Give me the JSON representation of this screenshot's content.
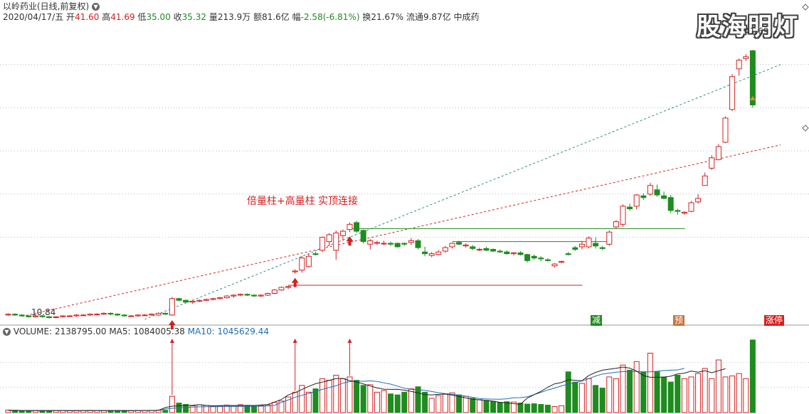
{
  "header": {
    "title": "以岭药业(日线,前复权)",
    "date": "2020/04/17/五",
    "open_label": "开",
    "open": "41.60",
    "high_label": "高",
    "high": "41.69",
    "low_label": "低",
    "low": "35.00",
    "close_label": "收",
    "close": "35.32",
    "vol_label": "量",
    "vol": "213.9万",
    "amount_label": "额",
    "amount": "81.6亿",
    "change_label": "幅",
    "change": "-2.58(-6.81%)",
    "turnover_label": "换",
    "turnover": "21.67%",
    "float_label": "流通",
    "float": "9.87亿",
    "sector": "中成药"
  },
  "watermark": "股海明灯",
  "annotation": "倍量柱+高量柱 实顶连接",
  "price_labels": {
    "low_mark": "10.84",
    "high_mark": "41.69"
  },
  "markers": {
    "jian": "减",
    "yu": "预",
    "zhangting": "涨停"
  },
  "volume_header": {
    "vol_label": "VOLUME:",
    "vol": "2138795.00",
    "ma5_label": "MA5:",
    "ma5": "1084005.38",
    "ma10_label": "MA10:",
    "ma10": "1045629.44"
  },
  "colors": {
    "up": "#d62020",
    "down": "#1e8c1e",
    "ma5": "#222222",
    "ma10": "#1e6fb8",
    "grid": "#bbbbbb"
  },
  "chart_data": {
    "type": "candlestick",
    "price_axis": [
      10,
      45
    ],
    "volume_axis": [
      0,
      2200000
    ],
    "candles": [
      [
        11.0,
        11.2,
        10.9,
        11.1
      ],
      [
        11.1,
        11.2,
        10.9,
        11.0
      ],
      [
        11.0,
        11.1,
        10.84,
        10.9
      ],
      [
        10.9,
        11.0,
        10.7,
        10.8
      ],
      [
        10.8,
        11.0,
        10.7,
        10.9
      ],
      [
        10.9,
        11.0,
        10.7,
        10.8
      ],
      [
        10.8,
        10.9,
        10.6,
        10.7
      ],
      [
        10.7,
        10.9,
        10.6,
        10.8
      ],
      [
        10.8,
        11.0,
        10.7,
        10.9
      ],
      [
        10.9,
        11.0,
        10.8,
        10.9
      ],
      [
        10.9,
        11.1,
        10.8,
        11.0
      ],
      [
        11.0,
        11.1,
        10.9,
        11.0
      ],
      [
        11.0,
        11.2,
        10.9,
        11.1
      ],
      [
        11.1,
        11.2,
        11.0,
        11.1
      ],
      [
        11.1,
        11.3,
        11.0,
        11.2
      ],
      [
        11.2,
        11.3,
        11.0,
        11.1
      ],
      [
        11.1,
        11.2,
        10.9,
        11.0
      ],
      [
        11.0,
        11.1,
        10.8,
        10.9
      ],
      [
        10.9,
        11.0,
        10.8,
        10.9
      ],
      [
        10.9,
        11.1,
        10.8,
        11.0
      ],
      [
        11.0,
        11.1,
        10.9,
        11.0
      ],
      [
        11.0,
        11.2,
        10.9,
        11.1
      ],
      [
        11.0,
        11.3,
        10.9,
        11.2
      ],
      [
        11.2,
        11.3,
        11.0,
        11.1
      ],
      [
        11.0,
        13.1,
        10.9,
        12.9
      ],
      [
        12.9,
        13.0,
        12.6,
        12.7
      ],
      [
        12.7,
        12.8,
        12.4,
        12.5
      ],
      [
        12.5,
        12.7,
        12.3,
        12.6
      ],
      [
        12.6,
        12.8,
        12.5,
        12.7
      ],
      [
        12.7,
        12.9,
        12.6,
        12.8
      ],
      [
        12.8,
        13.0,
        12.7,
        12.9
      ],
      [
        12.9,
        13.1,
        12.8,
        13.0
      ],
      [
        13.0,
        13.3,
        12.9,
        13.2
      ],
      [
        13.2,
        13.4,
        13.0,
        13.3
      ],
      [
        13.3,
        13.5,
        13.2,
        13.4
      ],
      [
        13.4,
        13.5,
        13.2,
        13.3
      ],
      [
        13.3,
        13.4,
        13.1,
        13.2
      ],
      [
        13.2,
        13.4,
        13.1,
        13.3
      ],
      [
        13.3,
        13.6,
        13.2,
        13.5
      ],
      [
        13.5,
        14.0,
        13.4,
        13.9
      ],
      [
        13.9,
        14.3,
        13.8,
        14.2
      ],
      [
        14.2,
        14.4,
        14.0,
        14.3
      ],
      [
        16.0,
        16.3,
        15.8,
        16.1
      ],
      [
        16.2,
        17.8,
        15.9,
        17.6
      ],
      [
        16.6,
        18.1,
        16.5,
        17.8
      ],
      [
        18.1,
        18.3,
        17.9,
        18.0
      ],
      [
        18.5,
        20.1,
        18.3,
        20.0
      ],
      [
        19.5,
        20.5,
        19.0,
        20.3
      ],
      [
        18.5,
        20.8,
        17.4,
        20.5
      ],
      [
        20.2,
        20.9,
        19.6,
        20.7
      ],
      [
        20.9,
        21.7,
        20.6,
        21.5
      ],
      [
        21.7,
        21.9,
        20.5,
        20.7
      ],
      [
        20.8,
        20.9,
        19.3,
        19.5
      ],
      [
        19.2,
        19.8,
        18.6,
        19.6
      ],
      [
        19.3,
        19.6,
        19.1,
        19.4
      ],
      [
        19.3,
        19.6,
        19.1,
        19.3
      ],
      [
        19.3,
        19.5,
        19.0,
        19.2
      ],
      [
        19.3,
        19.4,
        18.8,
        18.9
      ],
      [
        19.3,
        19.4,
        19.0,
        19.2
      ],
      [
        19.4,
        19.9,
        19.1,
        19.6
      ],
      [
        19.6,
        19.8,
        18.6,
        18.8
      ],
      [
        18.3,
        18.9,
        17.8,
        18.1
      ],
      [
        17.9,
        18.3,
        17.7,
        18.1
      ],
      [
        18.0,
        18.5,
        17.9,
        18.3
      ],
      [
        18.4,
        19.0,
        18.2,
        18.8
      ],
      [
        18.9,
        19.4,
        18.7,
        19.3
      ],
      [
        19.4,
        19.6,
        19.1,
        19.2
      ],
      [
        19.0,
        19.3,
        18.8,
        19.1
      ],
      [
        18.9,
        19.1,
        18.5,
        18.7
      ],
      [
        18.6,
        18.8,
        18.4,
        18.6
      ],
      [
        18.7,
        18.9,
        18.4,
        18.5
      ],
      [
        18.6,
        18.7,
        18.3,
        18.4
      ],
      [
        18.4,
        18.6,
        18.2,
        18.3
      ],
      [
        18.3,
        18.5,
        18.0,
        18.1
      ],
      [
        18.1,
        18.3,
        17.9,
        18.2
      ],
      [
        18.2,
        18.4,
        17.9,
        18.0
      ],
      [
        18.0,
        18.1,
        17.1,
        17.3
      ],
      [
        17.8,
        18.0,
        17.4,
        17.6
      ],
      [
        17.6,
        17.8,
        17.2,
        17.5
      ],
      [
        17.4,
        17.6,
        17.2,
        17.3
      ],
      [
        16.7,
        17.0,
        16.5,
        16.9
      ],
      [
        17.1,
        17.3,
        17.0,
        17.2
      ],
      [
        18.1,
        18.3,
        17.9,
        18.0
      ],
      [
        18.8,
        19.0,
        18.4,
        18.6
      ],
      [
        18.9,
        19.6,
        18.6,
        19.2
      ],
      [
        18.9,
        20.1,
        18.7,
        19.9
      ],
      [
        19.3,
        20.0,
        18.7,
        19.0
      ],
      [
        18.8,
        19.0,
        18.5,
        18.7
      ],
      [
        19.2,
        20.8,
        19.0,
        20.6
      ],
      [
        21.2,
        22.0,
        21.0,
        21.8
      ],
      [
        21.5,
        23.8,
        21.2,
        23.6
      ],
      [
        23.5,
        23.9,
        23.1,
        23.3
      ],
      [
        23.6,
        25.0,
        23.2,
        24.9
      ],
      [
        24.8,
        25.1,
        24.3,
        24.6
      ],
      [
        25.0,
        26.3,
        24.8,
        26.0
      ],
      [
        25.5,
        26.1,
        24.7,
        24.9
      ],
      [
        24.8,
        25.3,
        24.4,
        24.5
      ],
      [
        24.6,
        24.9,
        22.8,
        23.1
      ],
      [
        23.1,
        23.3,
        22.6,
        23.0
      ],
      [
        22.8,
        23.0,
        22.6,
        22.9
      ],
      [
        23.0,
        24.2,
        22.9,
        24.0
      ],
      [
        24.1,
        25.0,
        23.9,
        24.5
      ],
      [
        26.0,
        27.5,
        26.0,
        27.1
      ],
      [
        28.0,
        29.5,
        27.8,
        29.2
      ],
      [
        29.0,
        30.8,
        28.9,
        30.5
      ],
      [
        31.0,
        34.0,
        30.9,
        33.8
      ],
      [
        34.8,
        38.9,
        34.6,
        38.6
      ],
      [
        39.5,
        40.7,
        38.7,
        40.5
      ],
      [
        40.7,
        41.2,
        40.4,
        40.9
      ],
      [
        41.6,
        41.69,
        35.0,
        35.32
      ]
    ],
    "volumes": [
      75000,
      68000,
      62000,
      60000,
      58000,
      55000,
      57000,
      60000,
      62000,
      58000,
      56000,
      60000,
      65000,
      60000,
      58000,
      55000,
      60000,
      62000,
      58000,
      60000,
      62000,
      65000,
      70000,
      68000,
      480000,
      280000,
      240000,
      200000,
      230000,
      210000,
      190000,
      200000,
      220000,
      210000,
      230000,
      200000,
      190000,
      210000,
      230000,
      300000,
      340000,
      460000,
      600000,
      800000,
      600000,
      700000,
      1000000,
      950000,
      1100000,
      1000000,
      1050000,
      950000,
      800000,
      820000,
      600000,
      650000,
      550000,
      520000,
      600000,
      700000,
      760000,
      600000,
      420000,
      500000,
      550000,
      580000,
      520000,
      480000,
      420000,
      380000,
      360000,
      330000,
      300000,
      320000,
      310000,
      280000,
      250000,
      260000,
      240000,
      220000,
      180000,
      200000,
      1200000,
      900000,
      860000,
      1000000,
      800000,
      720000,
      1050000,
      1000000,
      1400000,
      1250000,
      1500000,
      1200000,
      1750000,
      1200000,
      1050000,
      900000,
      1100000,
      1000000,
      1050000,
      1150000,
      1300000,
      1000000,
      1550000,
      1050000,
      1080000,
      1150000,
      1000000,
      2138795
    ],
    "ma5": [
      64600,
      62200,
      59600,
      59600,
      60200,
      59400,
      58600,
      59000,
      59000,
      58800,
      60000,
      61400,
      60200,
      59400,
      59000,
      59800,
      59000,
      57600,
      57200,
      59400,
      61000,
      63000,
      65000,
      147000,
      189600,
      197600,
      211600,
      215200,
      232000,
      212000,
      200000,
      204400,
      211200,
      203200,
      210800,
      211200,
      210200,
      223800,
      238400,
      309800,
      388000,
      520600,
      588000,
      680000,
      772000,
      851000,
      897000,
      949000,
      1000000,
      1005000,
      940000,
      904000,
      844000,
      784000,
      728000,
      688000,
      684000,
      685000,
      659000,
      623000,
      580000,
      528000,
      520000,
      537000,
      545000,
      515000,
      474000,
      433000,
      396000,
      374000,
      357000,
      337000,
      302000,
      286000,
      262000,
      247000,
      429000,
      529000,
      624000,
      749000,
      847000,
      886000,
      966000,
      951000,
      937000,
      1091000,
      1184000,
      1249000,
      1279000,
      1305000,
      1340000,
      1310000,
      1221000,
      1090000,
      1040000,
      1040000,
      1044000,
      1072000,
      1139000,
      1161000,
      1222000,
      1188000,
      1232000,
      1174000,
      1234000,
      1293000
    ],
    "ma10": [
      68000,
      65000,
      63000,
      61500,
      60800,
      60100,
      59800,
      59500,
      59200,
      59000,
      59300,
      59800,
      60100,
      60000,
      59800,
      59500,
      59400,
      59200,
      59100,
      59200,
      60000,
      61200,
      62500,
      104000,
      125000,
      140000,
      152000,
      162000,
      170000,
      174000,
      174000,
      176000,
      178000,
      180000,
      182000,
      182000,
      183000,
      185000,
      199000,
      215000,
      297000,
      372000,
      452000,
      507000,
      563000,
      624000,
      683000,
      740000,
      790000,
      866000,
      915000,
      927000,
      922000,
      936000,
      917000,
      876000,
      838000,
      779000,
      714000,
      684000,
      678000,
      654000,
      620000,
      583000,
      559000,
      537000,
      518000,
      485000,
      447000,
      413000,
      401000,
      395000,
      392000,
      405000,
      438000,
      441000,
      465000,
      530000,
      595000,
      666000,
      720000,
      786000,
      838000,
      873000,
      931000,
      999000,
      1076000,
      1135000,
      1164000,
      1190000,
      1205000,
      1209000,
      1214000,
      1201000,
      1200000,
      1219000,
      1238000,
      1248000,
      1257000,
      1301000
    ],
    "trendlines": [
      {
        "color": "#d62020",
        "dash": true,
        "from": [
          2,
          10.84
        ],
        "to": [
          111,
          30.7
        ]
      },
      {
        "color": "#2e8a8a",
        "dash": true,
        "from": [
          20,
          10.5
        ],
        "to": [
          111,
          40.0
        ]
      },
      {
        "color": "#1e8c1e",
        "dash": false,
        "from": [
          50,
          21.0
        ],
        "to": [
          97,
          21.0
        ]
      },
      {
        "color": "#1e8c1e",
        "dash": false,
        "from": [
          65,
          19.5
        ],
        "to": [
          86,
          19.5
        ]
      },
      {
        "color": "#d62020",
        "dash": false,
        "from": [
          41,
          14.45
        ],
        "to": [
          82,
          14.45
        ]
      }
    ]
  }
}
